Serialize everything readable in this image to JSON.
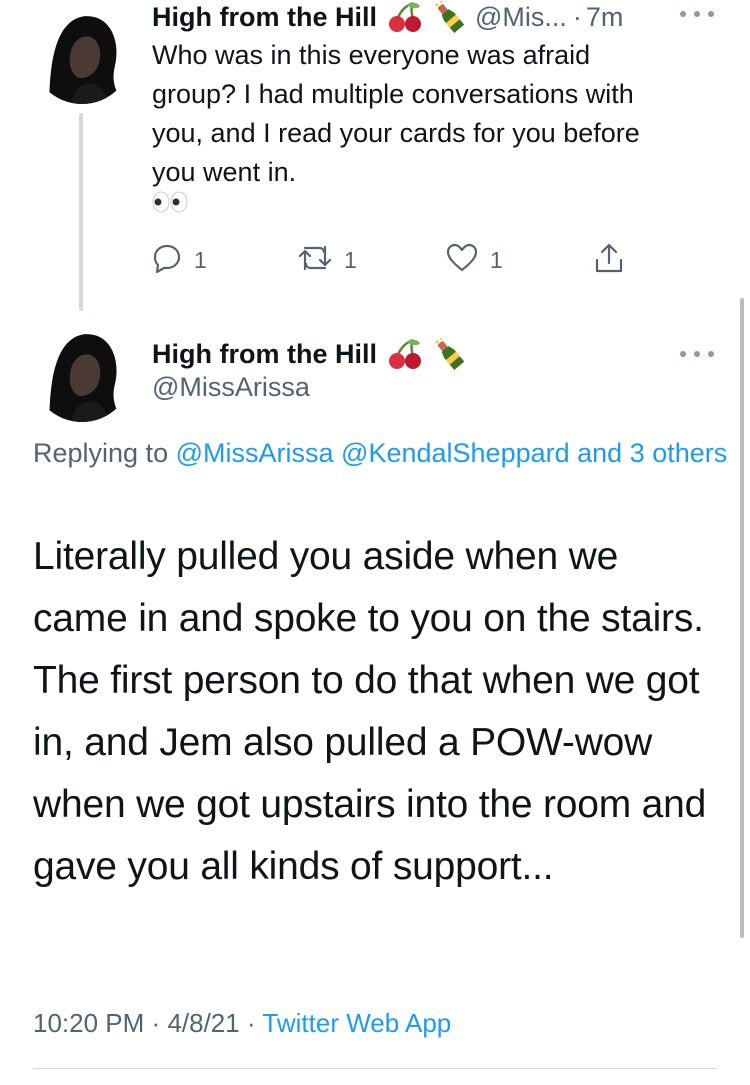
{
  "parent_tweet": {
    "display_name": "High from the Hill",
    "emojis": [
      "cherries-icon",
      "champagne-bottle-icon"
    ],
    "handle_truncated": "@Mis...",
    "separator": "·",
    "time_ago": "7m",
    "text": "Who was in this everyone was afraid\ngroup? I  had multiple conversations with\nyou, and I read your cards for you before\nyou went in.",
    "trailing_emoji": "eyes-icon",
    "actions": {
      "reply_count": "1",
      "retweet_count": "1",
      "like_count": "1"
    }
  },
  "main_tweet": {
    "display_name": "High from the Hill",
    "emojis": [
      "cherries-icon",
      "champagne-bottle-icon"
    ],
    "handle": "@MissArissa",
    "replying_prefix": "Replying to",
    "replying_users": [
      "@MissArissa",
      "@KendalSheppard",
      "and 3 others"
    ],
    "text": "Literally pulled you aside when we came in and spoke to you on the stairs. The first person to do that when we got in, and Jem also pulled a POW-wow when we got upstairs into the room and gave you all kinds of support...",
    "time": "10:20 PM",
    "date": "4/8/21",
    "separator": "·",
    "source": "Twitter Web App"
  },
  "colors": {
    "link": "#1d9bf0",
    "secondary_text": "#536471",
    "primary_text": "#0f1419",
    "border": "#cfd9de"
  }
}
